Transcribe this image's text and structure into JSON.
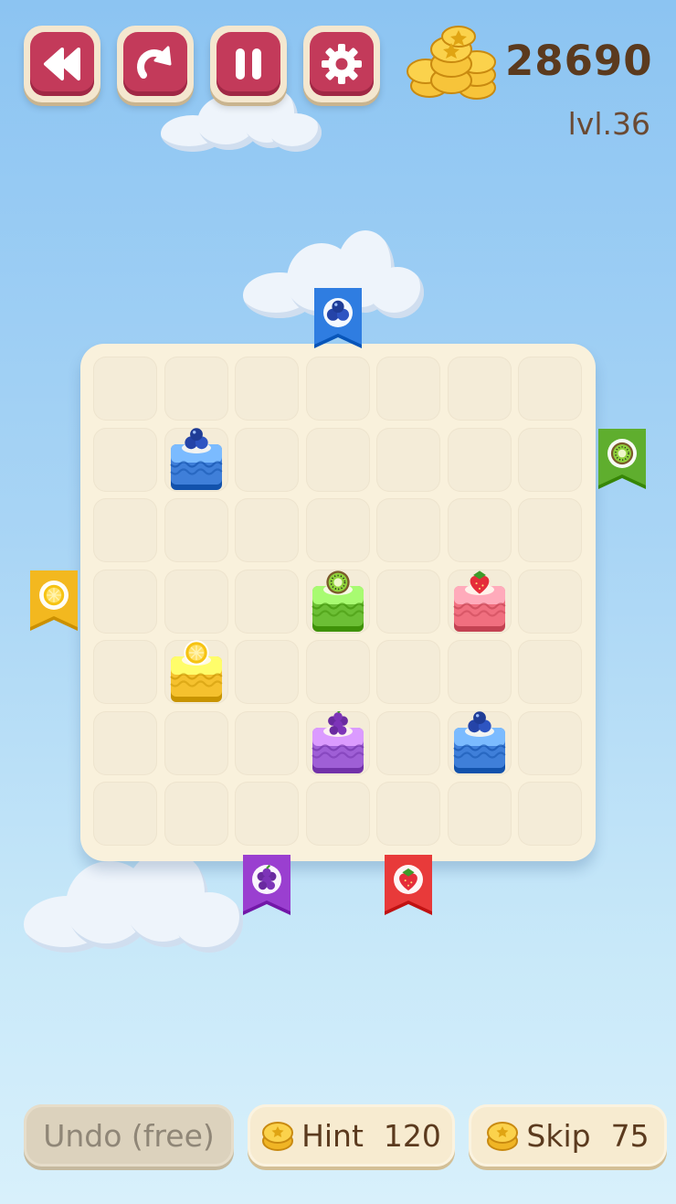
{
  "header": {
    "buttons": [
      {
        "name": "rewind-button",
        "icon": "rewind-icon"
      },
      {
        "name": "restart-button",
        "icon": "restart-icon"
      },
      {
        "name": "pause-button",
        "icon": "pause-icon"
      },
      {
        "name": "settings-button",
        "icon": "gear-icon"
      }
    ],
    "coins": "28690",
    "level": "lvl.36"
  },
  "board": {
    "rows": 7,
    "cols": 7,
    "blocks": [
      {
        "fruit": "blueberry",
        "color": "#3f7fd9",
        "row": 1,
        "col": 1
      },
      {
        "fruit": "kiwi",
        "color": "#6cbf35",
        "row": 3,
        "col": 3
      },
      {
        "fruit": "strawberry",
        "color": "#f06f7f",
        "row": 3,
        "col": 5
      },
      {
        "fruit": "lemon",
        "color": "#f5c12e",
        "row": 4,
        "col": 1
      },
      {
        "fruit": "grape",
        "color": "#9f5fd6",
        "row": 5,
        "col": 3
      },
      {
        "fruit": "blueberry",
        "color": "#3f7fd9",
        "row": 5,
        "col": 5
      }
    ],
    "exits": [
      {
        "fruit": "blueberry",
        "color": "#2f7de1",
        "side": "top",
        "index": 3
      },
      {
        "fruit": "kiwi",
        "color": "#5fae2e",
        "side": "right",
        "index": 1
      },
      {
        "fruit": "lemon",
        "color": "#f3b81f",
        "side": "left",
        "index": 3
      },
      {
        "fruit": "grape",
        "color": "#9a3fd0",
        "side": "bottom",
        "index": 2
      },
      {
        "fruit": "strawberry",
        "color": "#e83a3a",
        "side": "bottom",
        "index": 4
      }
    ]
  },
  "footer": {
    "undo_label": "Undo (free)",
    "hint_label": "Hint",
    "hint_cost": "120",
    "skip_label": "Skip",
    "skip_cost": "75"
  }
}
